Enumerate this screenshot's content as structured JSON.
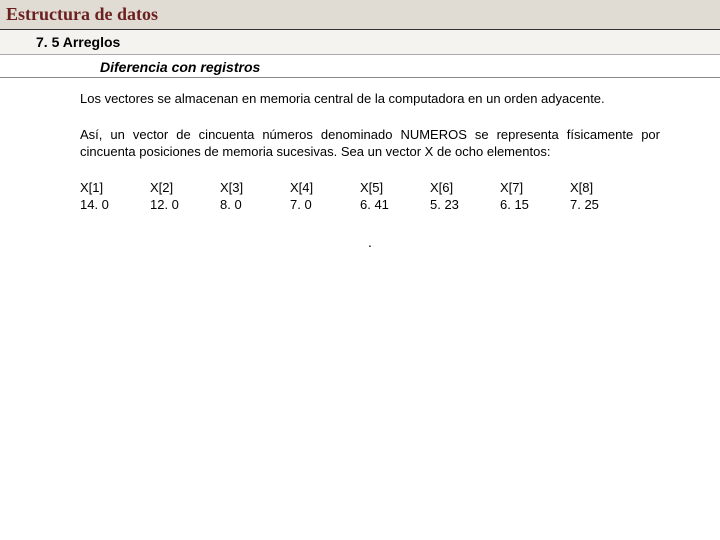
{
  "header": {
    "title": "Estructura de datos",
    "section": "7. 5 Arreglos",
    "subsection": "Diferencia con registros"
  },
  "body": {
    "p1": "Los vectores se almacenan en memoria central de la computadora en un orden adyacente.",
    "p2": "Así, un vector de cincuenta números denominado NUMEROS se representa físicamente por cincuenta posiciones de memoria sucesivas. Sea un vector X de ocho elementos:"
  },
  "array": [
    {
      "label": "X[1]",
      "value": "14. 0"
    },
    {
      "label": "X[2]",
      "value": "12. 0"
    },
    {
      "label": "X[3]",
      "value": "8. 0"
    },
    {
      "label": "X[4]",
      "value": "7. 0"
    },
    {
      "label": "X[5]",
      "value": "6. 41"
    },
    {
      "label": "X[6]",
      "value": "5. 23"
    },
    {
      "label": "X[7]",
      "value": "6. 15"
    },
    {
      "label": "X[8]",
      "value": "7. 25"
    }
  ],
  "footer_dot": "."
}
